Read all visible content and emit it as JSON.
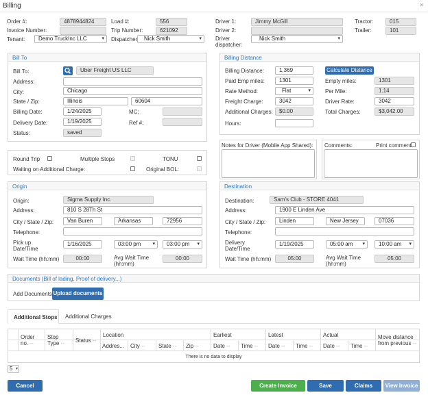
{
  "window": {
    "title": "Billing",
    "close": "×"
  },
  "header": {
    "order_label": "Order #:",
    "order_value": "4878944824",
    "invoice_label": "Invoice Number:",
    "invoice_value": "",
    "tenant_label": "Tenant:",
    "tenant_value": "Demo TruckInc LLC",
    "load_label": "Load #:",
    "load_value": "556",
    "trip_label": "Trip Number:",
    "trip_value": "621092",
    "dispatcher_label": "Dispatcher:",
    "dispatcher_value": "Nick Smith",
    "driver1_label": "Driver 1:",
    "driver1_value": "Jimmy  McGill",
    "driver2_label": "Driver 2:",
    "driver2_value": "",
    "driver_dispatcher_label_1": "Driver",
    "driver_dispatcher_label_2": "dispatcher:",
    "driver_dispatcher_value": "Nick Smith",
    "tractor_label": "Tractor:",
    "tractor_value": "015",
    "trailer_label": "Trailer:",
    "trailer_value": "101"
  },
  "bill_to": {
    "title": "Bill To",
    "bill_to_label": "Bill To:",
    "bill_to_value": "Uber Freight US LLC",
    "address_label": "Address:",
    "address_value": "",
    "city_label": "City:",
    "city_value": "Chicago",
    "state_zip_label": "State / Zip:",
    "state_value": "Illinois",
    "zip_value": "60604",
    "billing_date_label": "Billing Date:",
    "billing_date_value": "1/24/2025",
    "mc_label": "MC:",
    "mc_value": "",
    "delivery_date_label": "Delivery Date:",
    "delivery_date_value": "1/19/2025",
    "ref_label": "Ref #:",
    "ref_value": "",
    "status_label": "Status:",
    "status_value": "saved"
  },
  "billing_distance": {
    "title": "Billing Distance",
    "billing_distance_label": "Billing Distance:",
    "billing_distance_value": "1,369",
    "calc_button": "Calculate Distance",
    "paid_emp_label": "Paid Emp miles:",
    "paid_emp_value": "1301",
    "empty_miles_label": "Empty miles:",
    "empty_miles_value": "1301",
    "rate_method_label": "Rate Method:",
    "rate_method_value": "Flat",
    "per_mile_label": "Per Mile:",
    "per_mile_value": "1.14",
    "freight_charge_label": "Freight Charge:",
    "freight_charge_value": "3042",
    "driver_rate_label": "Driver Rate:",
    "driver_rate_value": "3042",
    "additional_charges_label": "Additional Charges:",
    "additional_charges_value": "$0.00",
    "total_charges_label": "Total Charges:",
    "total_charges_value": "$3,042.00",
    "hours_label": "Hours:",
    "hours_value": ""
  },
  "options": {
    "round_trip": "Round Trip",
    "multiple_stops": "Multiple Stops",
    "tonu": "TONU",
    "waiting": "Waiting on Additional Charge:",
    "original_bol": "Original BOL:"
  },
  "notes": {
    "driver_notes_label": "Notes for Driver (Mobile App Shared):",
    "comments_label": "Comments:",
    "print_comment_label": "Print comment"
  },
  "origin": {
    "title": "Origin",
    "origin_label": "Origin:",
    "origin_value": "Sigma Supply Inc.",
    "address_label": "Address:",
    "address_value": "810 S 28Th St",
    "csz_label": "City / State / Zip:",
    "city_value": "Van Buren",
    "state_value": "Arkansas",
    "zip_value": "72956",
    "telephone_label": "Telephone:",
    "telephone_value": "",
    "pickup_label_1": "Pick up",
    "pickup_label_2": "Date/Time",
    "pickup_date": "1/16/2025",
    "pickup_time_from": "03:00 pm",
    "pickup_time_to": "03:00 pm",
    "wait_label": "Wait Time (hh:mm)",
    "wait_value": "00:00",
    "avg_wait_label_1": "Avg Wait Time",
    "avg_wait_label_2": "(hh:mm)",
    "avg_wait_value": "00:00"
  },
  "destination": {
    "title": "Destination",
    "destination_label": "Destination:",
    "destination_value": "Sam's Club - STORE 4041",
    "address_label": "Address:",
    "address_value": "1900 E Linden Ave",
    "csz_label": "City / State / Zip:",
    "city_value": "Linden",
    "state_value": "New Jersey",
    "zip_value": "07036",
    "telephone_label": "Telephone:",
    "telephone_value": "",
    "delivery_label_1": "Delivery",
    "delivery_label_2": "Date/Time",
    "delivery_date": "1/19/2025",
    "delivery_time_from": "05:00 am",
    "delivery_time_to": "10:00 am",
    "wait_label": "Wait Time (hh:mm)",
    "wait_value": "05:00",
    "avg_wait_label_1": "Avg Wait Time",
    "avg_wait_label_2": "(hh:mm)",
    "avg_wait_value": "05:00"
  },
  "documents": {
    "title": "Documents (Bill of lading, Proof of delivery...)",
    "add_label": "Add Documents:",
    "upload_button": "Upload documents"
  },
  "tabs": {
    "stops": "Additional Stops",
    "charges": "Additional Charges"
  },
  "table": {
    "order_1": "Order",
    "order_2": "no.",
    "stop_type_1": "Stop",
    "stop_type_2": "Type",
    "status": "Status",
    "location": "Location",
    "address": "Addres...",
    "city": "City",
    "state": "State",
    "zip": "Zip",
    "earliest": "Earliest",
    "latest": "Latest",
    "actual": "Actual",
    "date": "Date",
    "time": "Time",
    "move_1": "Move distance",
    "move_2": "from previous",
    "sort_mark": "--",
    "empty_message": "There is no data to display"
  },
  "pager": {
    "page_size": "5"
  },
  "footer": {
    "cancel": "Cancel",
    "create_invoice": "Create Invoice",
    "save": "Save",
    "claims": "Claims",
    "view_invoice": "View Invoice"
  },
  "colors": {
    "primary": "#2f6db0",
    "success": "#4cae4c",
    "disabled": "#8fb0d4",
    "accent_title": "#2a7ac4"
  }
}
